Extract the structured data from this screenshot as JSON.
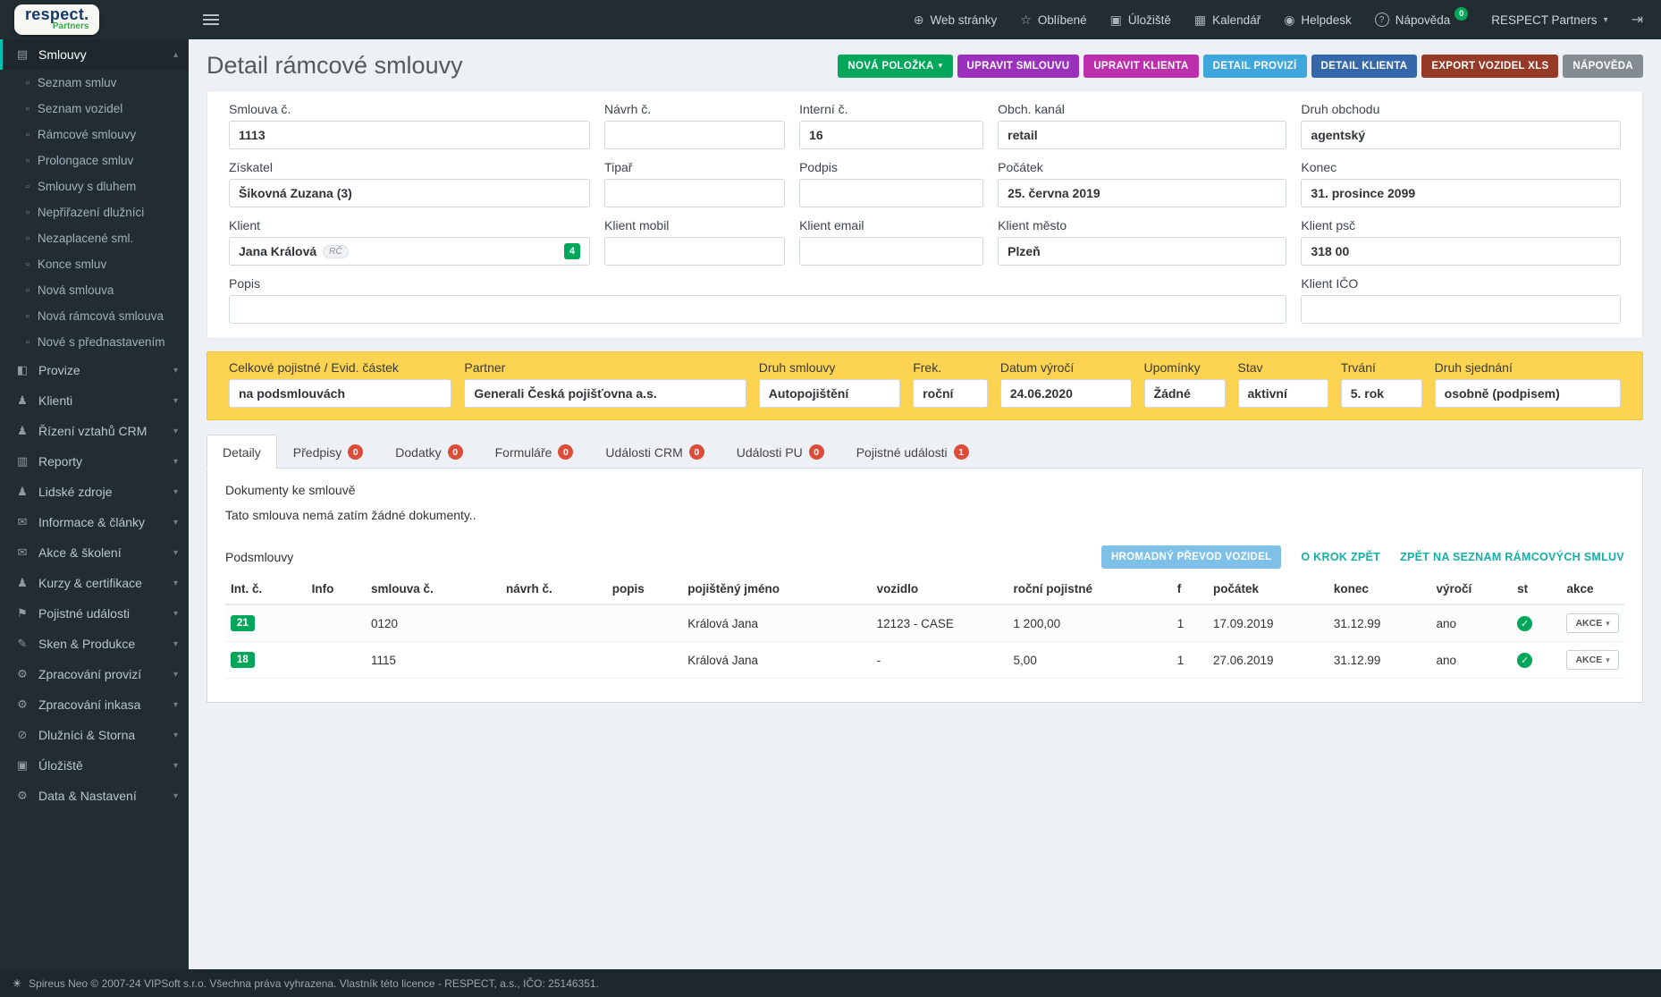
{
  "icons": {
    "globe": "⊕",
    "star": "☆",
    "box": "▣",
    "calendar": "▦",
    "helpdesk": "◉",
    "question": "?",
    "caret_down": "▾",
    "caret_up": "▴",
    "logout": "⇥",
    "check": "✓",
    "doc": "▫",
    "footer_mark": "✳"
  },
  "topbar": {
    "logo": {
      "main": "respect.",
      "sub": "Partners"
    },
    "menu": {
      "web": "Web stránky",
      "favorites": "Oblíbené",
      "storage": "Úložiště",
      "calendar": "Kalendář",
      "helpdesk": "Helpdesk",
      "help": "Nápověda",
      "help_badge": "0",
      "account": "RESPECT Partners"
    }
  },
  "sidebar": {
    "smlouvy": {
      "label": "Smlouvy",
      "icon": "▤",
      "children": [
        "Seznam smluv",
        "Seznam vozidel",
        "Rámcové smlouvy",
        "Prolongace smluv",
        "Smlouvy s dluhem",
        "Nepřiřazení dlužníci",
        "Nezaplacené sml.",
        "Konce smluv",
        "Nová smlouva",
        "Nová rámcová smlouva",
        "Nové s přednastavením"
      ]
    },
    "items": [
      {
        "label": "Provize",
        "icon": "◧"
      },
      {
        "label": "Klienti",
        "icon": "♟"
      },
      {
        "label": "Řízení vztahů CRM",
        "icon": "♟"
      },
      {
        "label": "Reporty",
        "icon": "▥"
      },
      {
        "label": "Lidské zdroje",
        "icon": "♟"
      },
      {
        "label": "Informace & články",
        "icon": "✉"
      },
      {
        "label": "Akce & školení",
        "icon": "✉"
      },
      {
        "label": "Kurzy & certifikace",
        "icon": "♟"
      },
      {
        "label": "Pojistné události",
        "icon": "⚑"
      },
      {
        "label": "Sken & Produkce",
        "icon": "✎"
      },
      {
        "label": "Zpracování provizí",
        "icon": "⚙"
      },
      {
        "label": "Zpracování inkasa",
        "icon": "⚙"
      },
      {
        "label": "Dlužníci & Storna",
        "icon": "⊘"
      },
      {
        "label": "Úložiště",
        "icon": "▣"
      },
      {
        "label": "Data & Nastavení",
        "icon": "⚙"
      }
    ]
  },
  "page": {
    "title": "Detail rámcové smlouvy",
    "actions": {
      "new_item": "NOVÁ POLOŽKA",
      "edit_contract": "UPRAVIT SMLOUVU",
      "edit_client": "UPRAVIT KLIENTA",
      "commission_detail": "DETAIL PROVIZÍ",
      "client_detail": "DETAIL KLIENTA",
      "export_vehicles": "EXPORT VOZIDEL XLS",
      "help": "NÁPOVĚDA"
    }
  },
  "form": {
    "contract_no": {
      "label": "Smlouva č.",
      "value": "1113"
    },
    "proposal_no": {
      "label": "Návrh č.",
      "value": ""
    },
    "internal_no": {
      "label": "Interní č.",
      "value": "16"
    },
    "channel": {
      "label": "Obch. kanál",
      "value": "retail"
    },
    "trade_type": {
      "label": "Druh obchodu",
      "value": "agentský"
    },
    "acquirer": {
      "label": "Získatel",
      "value": "Šikovná Zuzana (3)"
    },
    "tipster": {
      "label": "Tipař",
      "value": ""
    },
    "signature": {
      "label": "Podpis",
      "value": ""
    },
    "start_date": {
      "label": "Počátek",
      "value": "25. června 2019"
    },
    "end_date": {
      "label": "Konec",
      "value": "31. prosince 2099"
    },
    "client": {
      "label": "Klient",
      "value": "Jana Králová",
      "tag": "RČ",
      "count": "4"
    },
    "client_mobile": {
      "label": "Klient mobil",
      "value": ""
    },
    "client_email": {
      "label": "Klient email",
      "value": ""
    },
    "client_city": {
      "label": "Klient město",
      "value": "Plzeň"
    },
    "client_zip": {
      "label": "Klient psč",
      "value": "318 00"
    },
    "description": {
      "label": "Popis",
      "value": ""
    },
    "client_ico": {
      "label": "Klient IČO",
      "value": ""
    }
  },
  "summary": {
    "total_premium": {
      "label": "Celkové pojistné / Evid. částek",
      "value": "na podsmlouvách"
    },
    "partner": {
      "label": "Partner",
      "value": "Generali Česká pojišťovna a.s."
    },
    "contract_type": {
      "label": "Druh smlouvy",
      "value": "Autopojištění"
    },
    "frequency": {
      "label": "Frek.",
      "value": "roční"
    },
    "anniversary_date": {
      "label": "Datum výročí",
      "value": "24.06.2020"
    },
    "reminders": {
      "label": "Upomínky",
      "value": "Žádné"
    },
    "status": {
      "label": "Stav",
      "value": "aktivní"
    },
    "duration": {
      "label": "Trvání",
      "value": "5. rok"
    },
    "arrangement": {
      "label": "Druh sjednání",
      "value": "osobně (podpisem)"
    }
  },
  "tabs": {
    "details": {
      "label": "Detaily"
    },
    "prescriptions": {
      "label": "Předpisy",
      "badge": "0"
    },
    "amendments": {
      "label": "Dodatky",
      "badge": "0"
    },
    "forms": {
      "label": "Formuláře",
      "badge": "0"
    },
    "crm_events": {
      "label": "Události CRM",
      "badge": "0"
    },
    "pu_events": {
      "label": "Události PU",
      "badge": "0"
    },
    "claims": {
      "label": "Pojistné události",
      "badge": "1"
    }
  },
  "documents": {
    "title": "Dokumenty ke smlouvě",
    "empty": "Tato smlouva nemá zatím žádné dokumenty.."
  },
  "subcontracts": {
    "title": "Podsmlouvy",
    "bulk_transfer": "HROMADNÝ PŘEVOD VOZIDEL",
    "step_back": "O KROK ZPĚT",
    "back_to_list": "ZPĚT NA SEZNAM RÁMCOVÝCH SMLUV",
    "action_label": "AKCE",
    "headers": [
      "Int. č.",
      "Info",
      "smlouva č.",
      "návrh č.",
      "popis",
      "pojištěný jméno",
      "vozidlo",
      "roční pojistné",
      "f",
      "počátek",
      "konec",
      "výročí",
      "st",
      "akce"
    ],
    "rows": [
      {
        "int_no": "21",
        "info": "",
        "contract_no": "0120",
        "proposal_no": "",
        "desc": "",
        "insured": "Králová Jana",
        "vehicle": "12123 - CASE",
        "premium": "1 200,00",
        "f": "1",
        "start": "17.09.2019",
        "end": "31.12.99",
        "anniv": "ano"
      },
      {
        "int_no": "18",
        "info": "",
        "contract_no": "1115",
        "proposal_no": "",
        "desc": "",
        "insured": "Králová Jana",
        "vehicle": "-",
        "premium": "5,00",
        "f": "1",
        "start": "27.06.2019",
        "end": "31.12.99",
        "anniv": "ano"
      }
    ]
  },
  "footer": {
    "text": "Spireus Neo © 2007-24 VIPSoft s.r.o. Všechna práva vyhrazena. Vlastník této licence - RESPECT, a.s., IČO: 25146351."
  },
  "colors": {
    "accent_green": "#00a65a",
    "badge_red": "#dd4b39",
    "summary_yellow": "#fcd451",
    "link_teal": "#14b0a6",
    "bulk_blue": "#7fc0e8",
    "btn_purple": "#9b30bd",
    "btn_magenta": "#bd30ad",
    "btn_blue": "#3fa7dc",
    "btn_dark_blue": "#3568a8",
    "btn_maroon": "#963a28",
    "btn_gray": "#848c92"
  }
}
